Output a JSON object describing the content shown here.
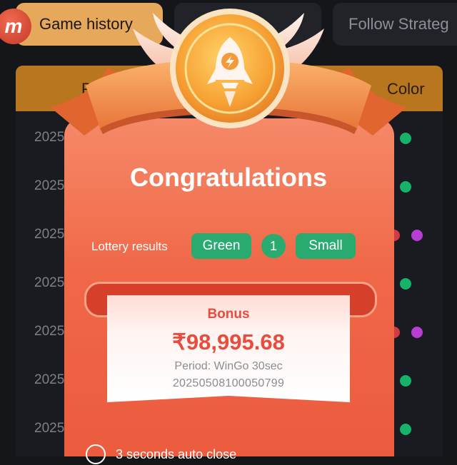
{
  "tabs": {
    "game_history": "Game history",
    "follow_strategy": "Follow Strateg"
  },
  "logo": {
    "letter": "m"
  },
  "table": {
    "header_first": "P",
    "header_color": "Color",
    "rows": [
      {
        "period": "2025",
        "dots": [
          "green"
        ]
      },
      {
        "period": "2025",
        "dots": [
          "green"
        ]
      },
      {
        "period": "2025",
        "dots": [
          "red",
          "violet"
        ]
      },
      {
        "period": "2025",
        "dots": [
          "green"
        ]
      },
      {
        "period": "2025",
        "dots": [
          "red",
          "violet"
        ]
      },
      {
        "period": "2025",
        "dots": [
          "green"
        ]
      },
      {
        "period": "2025",
        "dots": [
          "green"
        ]
      }
    ]
  },
  "popup": {
    "title": "Congratulations",
    "lottery_label": "Lottery results",
    "result_color": "Green",
    "result_number": "1",
    "result_size": "Small",
    "bonus_label": "Bonus",
    "amount": "₹98,995.68",
    "period_line": "Period: WinGo 30sec",
    "issue_number": "20250508100050799",
    "auto_close": "3 seconds auto close"
  },
  "colors": {
    "green": "#29ab70",
    "red": "#d23a44",
    "violet": "#b63fd1",
    "accent_orange": "#f06848",
    "gold": "#e6a85a"
  }
}
